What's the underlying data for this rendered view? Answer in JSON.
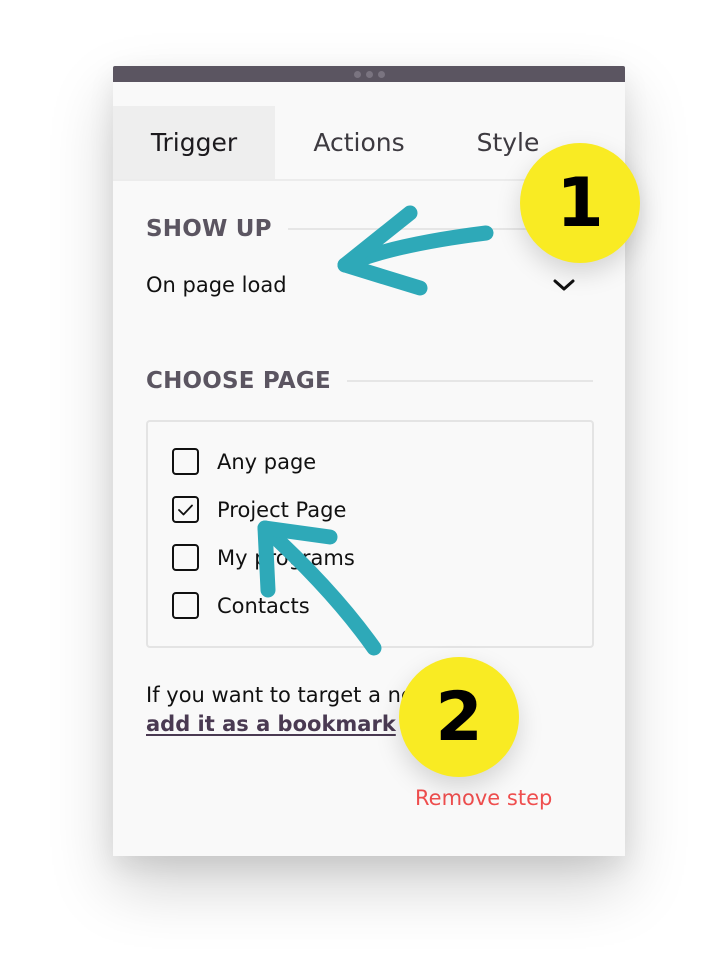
{
  "window": {
    "dots_count": 3
  },
  "tabs": [
    {
      "label": "Trigger",
      "active": true
    },
    {
      "label": "Actions",
      "active": false
    },
    {
      "label": "Style",
      "active": false
    }
  ],
  "show_up": {
    "heading": "SHOW UP",
    "selected_value": "On page load",
    "dropdown_icon": "chevron-down-icon"
  },
  "choose_page": {
    "heading": "CHOOSE PAGE",
    "options": [
      {
        "label": "Any page",
        "checked": false
      },
      {
        "label": "Project Page",
        "checked": true
      },
      {
        "label": "My programs",
        "checked": false
      },
      {
        "label": "Contacts",
        "checked": false
      }
    ]
  },
  "helper": {
    "text": "If you want to target a new page,",
    "link_label": "add it as a bookmark"
  },
  "remove_step_label": "Remove step",
  "annotations": {
    "badge_1": "1",
    "badge_2": "2",
    "arrow_color": "#2ea9b8",
    "badge_color": "#f9eb23"
  }
}
